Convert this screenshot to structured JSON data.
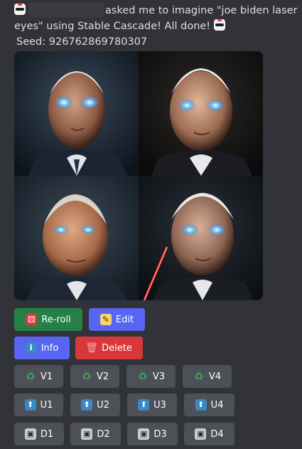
{
  "message": {
    "text_after_mention": "asked me to imagine \"joe biden laser eyes\" using Stable Cascade! All done!",
    "seed_line": "Seed: 926762869780307"
  },
  "buttons": {
    "reroll": "Re-roll",
    "edit": "Edit",
    "info": "Info",
    "delete": "Delete",
    "variations": [
      "V1",
      "V2",
      "V3",
      "V4"
    ],
    "upscales": [
      "U1",
      "U2",
      "U3",
      "U4"
    ],
    "downloads": [
      "D1",
      "D2",
      "D3",
      "D4"
    ]
  },
  "icons": {
    "bot": "robot-face-icon",
    "reroll": "game-die-icon",
    "edit": "memo-icon",
    "info": "information-icon",
    "delete": "wastebasket-icon",
    "variation": "recycle-icon",
    "upscale": "up-arrow-icon",
    "download": "floppy-disk-icon"
  },
  "colors": {
    "background": "#313338",
    "text": "#dbdee1",
    "green_button": "#248046",
    "blurple_button": "#5865f2",
    "red_button": "#da373c",
    "grey_button": "#4e5058",
    "laser_eye_blue": "#5cc8ff",
    "laser_red": "#ff2a2a"
  }
}
